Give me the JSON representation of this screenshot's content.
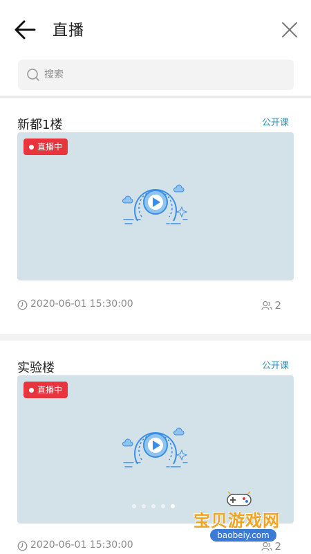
{
  "header": {
    "title": "直播",
    "back_icon": "arrow-left-icon",
    "close_icon": "close-icon"
  },
  "search": {
    "placeholder": "搜索",
    "value": "",
    "icon": "search-icon"
  },
  "rooms": [
    {
      "name": "新都1楼",
      "course_tag": "公开课",
      "status": "直播中",
      "time": "2020-06-01 15:30:00",
      "viewers": "2"
    },
    {
      "name": "实验楼",
      "course_tag": "公开课",
      "status": "直播中",
      "time": "2020-06-01 15:30:00",
      "viewers": "2"
    }
  ],
  "carousel": {
    "dot_count": 5,
    "active_index": 4
  },
  "watermark": {
    "title": "宝贝游戏网",
    "url": "baobeiy.com"
  },
  "colors": {
    "accent": "#2a8fb0",
    "live_badge": "#e8343d",
    "thumbnail_bg": "#d3e2e9",
    "play_blue": "#3a8ee6",
    "muted_text": "#8a8a8a"
  }
}
